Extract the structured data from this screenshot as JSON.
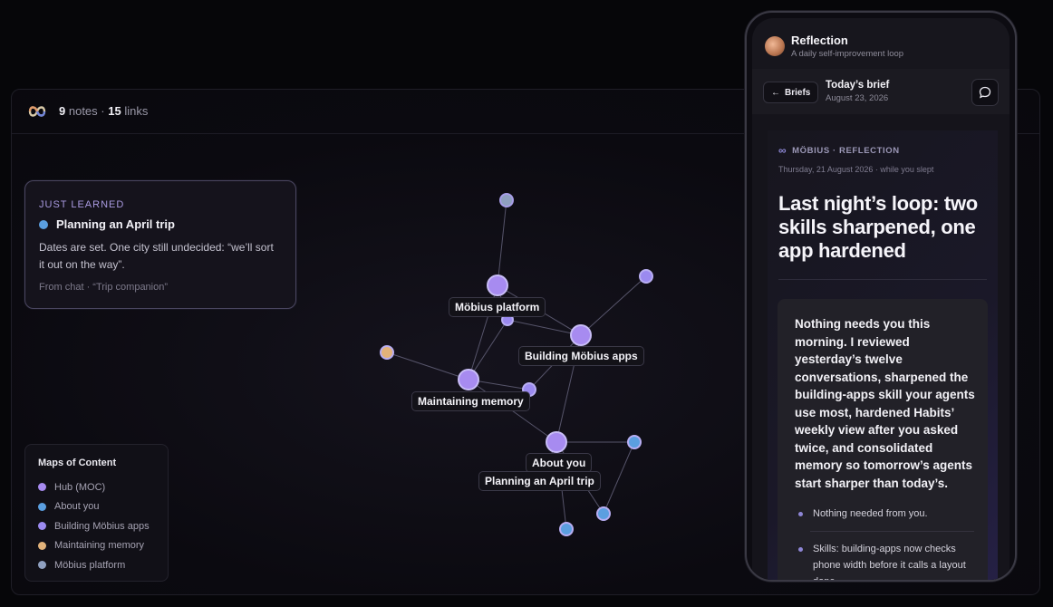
{
  "header": {
    "notes_count": "9",
    "notes_label": "notes ·",
    "links_count": "15",
    "links_label": "links"
  },
  "just_learned": {
    "kicker": "JUST LEARNED",
    "title": "Planning an April trip",
    "body": "Dates are set. One city still undecided: “we’ll sort it out on the way”.",
    "source": "From chat · “Trip companion”",
    "dot_color": "#5b9fe0"
  },
  "legend": {
    "title": "Maps of Content",
    "items": [
      {
        "label": "Hub (MOC)",
        "color": "#a78bf0"
      },
      {
        "label": "About you",
        "color": "#5b9fe0"
      },
      {
        "label": "Building Möbius apps",
        "color": "#9b8af0"
      },
      {
        "label": "Maintaining memory",
        "color": "#e2b27a"
      },
      {
        "label": "Möbius platform",
        "color": "#8fa0c0"
      }
    ]
  },
  "graph": {
    "labels": {
      "mobius_platform": "Möbius platform",
      "building_apps": "Building Möbius apps",
      "maintaining_memory": "Maintaining memory",
      "about_you": "About you",
      "april_trip": "Planning an April trip"
    }
  },
  "phone": {
    "app_title": "Reflection",
    "app_subtitle": "A daily self-improvement loop",
    "back_label": "Briefs",
    "brief_title": "Today’s brief",
    "brief_date": "August 23, 2026",
    "doc_kicker": "MÖBIUS · REFLECTION",
    "doc_date": "Thursday, 21 August 2026 · while you slept",
    "headline": "Last night’s loop: two skills sharpened, one app hardened",
    "lead": "Nothing needs you this morning. I reviewed yesterday’s twelve conversations, sharpened the building-apps skill your agents use most, hardened Habits’ weekly view after you asked twice, and consolidated memory so tomorrow’s agents start sharper than today’s.",
    "bullets": [
      "Nothing needed from you.",
      "Skills: building-apps now checks phone width before it calls a layout done."
    ]
  }
}
